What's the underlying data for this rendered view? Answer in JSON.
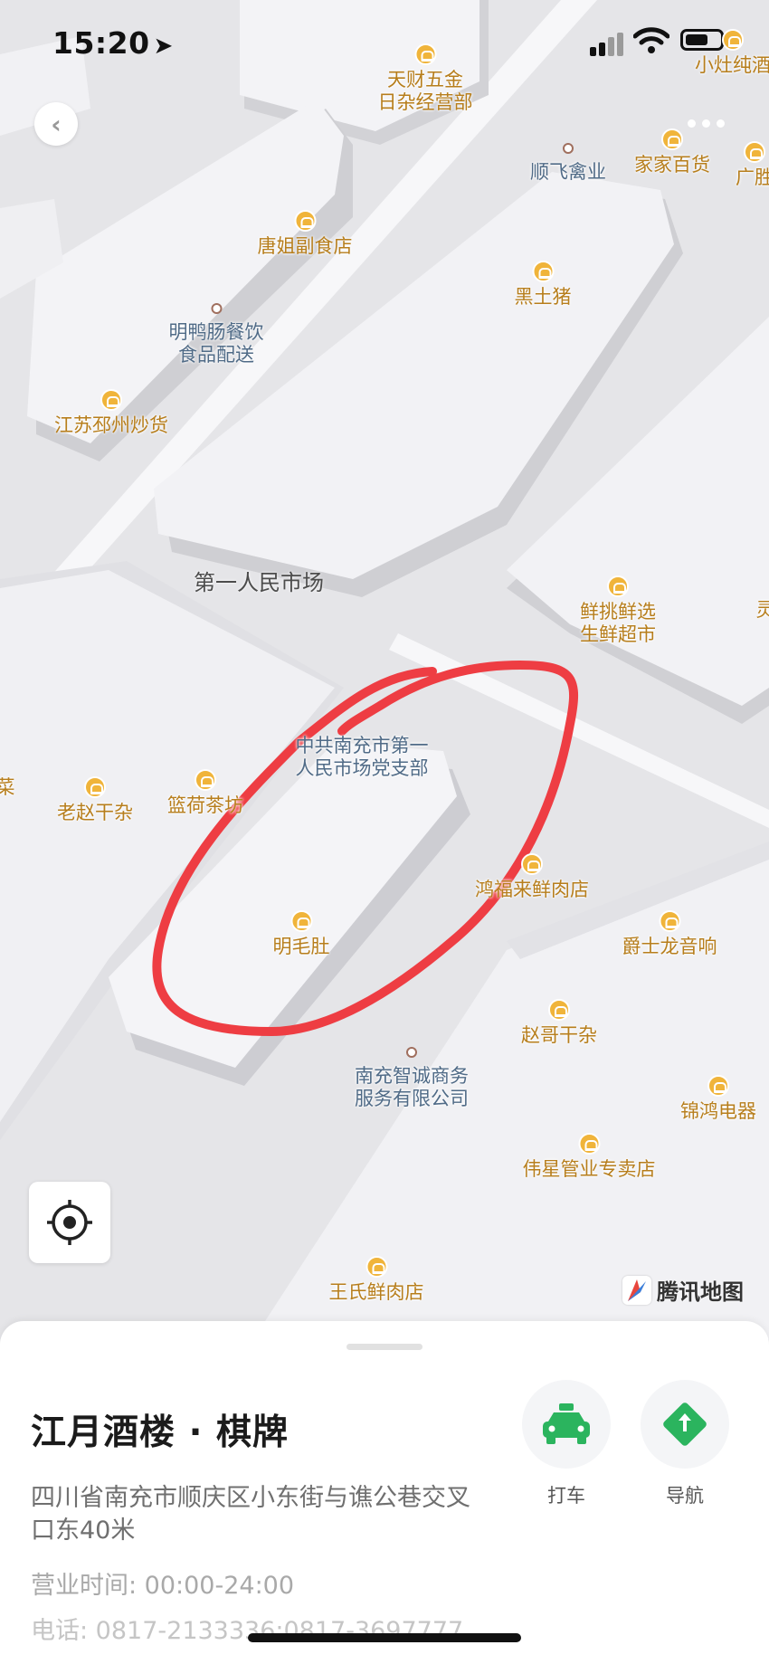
{
  "status_bar": {
    "time": "15:20"
  },
  "map": {
    "pois": [
      {
        "id": "tiancai",
        "label": "天财五金\n日杂经营部",
        "kind": "shop"
      },
      {
        "id": "xiaozao",
        "label": "小灶纯酒",
        "kind": "shop"
      },
      {
        "id": "shunfei",
        "label": "顺飞禽业",
        "kind": "dot"
      },
      {
        "id": "jiajia",
        "label": "家家百货",
        "kind": "shop"
      },
      {
        "id": "guangsheng",
        "label": "广胜",
        "kind": "shop"
      },
      {
        "id": "tangjie",
        "label": "唐姐副食店",
        "kind": "shop"
      },
      {
        "id": "heitu",
        "label": "黑土猪",
        "kind": "shop"
      },
      {
        "id": "mingya",
        "label": "明鸭肠餐饮\n食品配送",
        "kind": "dot"
      },
      {
        "id": "jiangsu",
        "label": "江苏邳州炒货",
        "kind": "shop"
      },
      {
        "id": "xiantiao",
        "label": "鲜挑鲜选\n生鲜超市",
        "kind": "shop"
      },
      {
        "id": "dangzhibu",
        "label": "中共南充市第一\n人民市场党支部",
        "kind": "text"
      },
      {
        "id": "laozhao",
        "label": "老赵干杂",
        "kind": "shop"
      },
      {
        "id": "lanhe",
        "label": "篮荷茶坊",
        "kind": "shop"
      },
      {
        "id": "hongfulai",
        "label": "鸿福来鲜肉店",
        "kind": "shop"
      },
      {
        "id": "mingmaodu",
        "label": "明毛肚",
        "kind": "shop"
      },
      {
        "id": "jueshilong",
        "label": "爵士龙音响",
        "kind": "shop"
      },
      {
        "id": "zhaoge",
        "label": "赵哥干杂",
        "kind": "shop"
      },
      {
        "id": "zhicheng",
        "label": "南充智诚商务\n服务有限公司",
        "kind": "dot"
      },
      {
        "id": "jinhong",
        "label": "锦鸿电器",
        "kind": "shop"
      },
      {
        "id": "weixing",
        "label": "伟星管业专卖店",
        "kind": "shop"
      },
      {
        "id": "wangshi",
        "label": "王氏鲜肉店",
        "kind": "shop"
      },
      {
        "id": "cai",
        "label": "菜",
        "kind": "text"
      },
      {
        "id": "ling",
        "label": "灵",
        "kind": "text"
      }
    ],
    "area_label": "第一人民市场",
    "provider": "腾讯地图",
    "highlight_color": "#ee3d43"
  },
  "sheet": {
    "name": "江月酒楼 · 棋牌",
    "address": "四川省南充市顺庆区小东街与谯公巷交叉口东40米",
    "hours": "营业时间:  00:00-24:00",
    "phone": "电话:  0817-2133336;0817-3697777",
    "actions": [
      {
        "label": "打车",
        "icon": "taxi-icon",
        "color": "#2bb45e"
      },
      {
        "label": "导航",
        "icon": "navigation-icon",
        "color": "#2bb45e"
      }
    ]
  }
}
